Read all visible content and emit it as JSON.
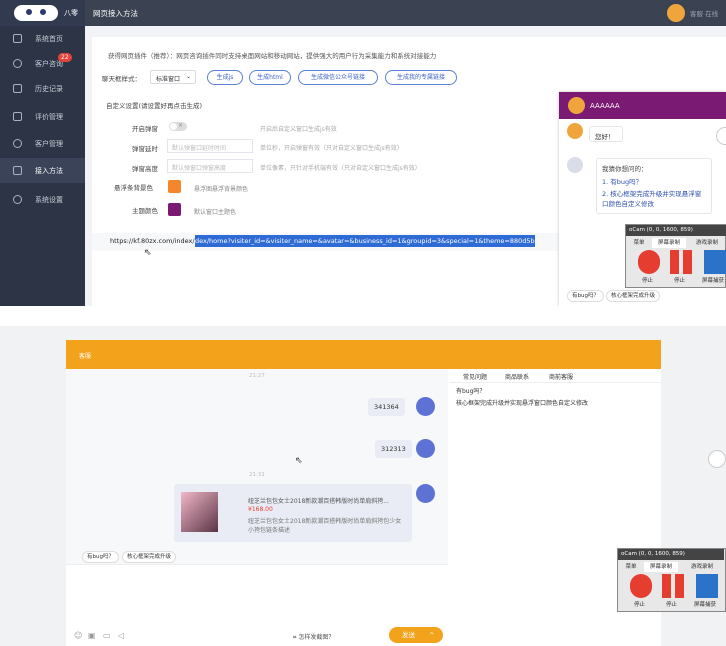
{
  "sidebar": {
    "brand": "八零",
    "items": [
      {
        "label": "系统首页"
      },
      {
        "label": "客户咨询",
        "badge": "22"
      },
      {
        "label": "历史记录"
      },
      {
        "label": "评价管理"
      },
      {
        "label": "客户管理"
      },
      {
        "label": "接入方法"
      },
      {
        "label": "系统设置"
      }
    ]
  },
  "topbar": {
    "title": "网页接入方法",
    "user": "客服 在线"
  },
  "main": {
    "intro": "获得网页插件（推荐）：网页咨询插件同时支持桌面网站和移动网站，提供强大的用户行为采集能力和系统对接能力",
    "style_label": "聊天框样式：",
    "style_value": "标准窗口",
    "buttons": [
      "生成js",
      "生成html",
      "生成微信公众号链接",
      "生成我的专属链接"
    ],
    "custom_title": "自定义设置(请设置好再点击生成)",
    "settings": [
      {
        "label": "开启弹窗",
        "value": "",
        "hint": "开启后自定义窗口生成js有效"
      },
      {
        "label": "弹窗延时",
        "value": "默认弹窗口延时时间",
        "hint": "单位秒，开启弹窗有效（只对自定义窗口生成js有效）"
      },
      {
        "label": "弹窗高度",
        "value": "默认弹窗口弹窗高度",
        "hint": "单位像素，只针对手机端有效（只对自定义窗口生成js有效）"
      },
      {
        "label": "悬浮条背景色",
        "value": "",
        "hint": "悬浮图悬浮背景颜色"
      },
      {
        "label": "主题颜色",
        "value": "",
        "hint": "默认窗口主题色"
      }
    ],
    "url_plain": "https://kf.80zx.com/index/in",
    "url_selected": "dex/home?visiter_id=&visiter_name=&avatar=&business_id=1&groupid=3&special=1&theme=880d5b"
  },
  "widget": {
    "name": "AAAAAA",
    "greeting": "您好！",
    "faq_title": "我猜你想问的：",
    "faq": [
      "1. 有bug吗？",
      "2. 核心框架完成升级并实现悬浮窗口颜色自定义修改"
    ],
    "quick": [
      "有bug吗？",
      "核心框架完成升级"
    ]
  },
  "ocam": {
    "title": "oCam (0, 0, 1600, 859)",
    "tabs": [
      "菜单",
      "屏幕录制",
      "游戏录制"
    ],
    "buttons": [
      "停止",
      "停止",
      "屏幕捕获"
    ]
  },
  "chat": {
    "title": "客服",
    "times": [
      "21:27",
      "21:31"
    ],
    "messages": [
      "341364",
      "312313"
    ],
    "product": {
      "title": "纽芝兰包包女士2018新款潮百搭韩版时尚单肩斜挎...",
      "price": "¥168.00",
      "desc": "纽芝兰包包女士2018新款潮百搭韩版时尚单肩斜挎包少女小挎包链条描述"
    },
    "quick": [
      "有bug吗？",
      "核心框架完成升级"
    ],
    "tabs": [
      "常见问题",
      "商品联系",
      "商前客服"
    ],
    "faq": [
      "有bug吗？",
      "核心框架完成升级并实现悬浮窗口颜色自定义修改"
    ],
    "screenshot": "怎样发截图？",
    "send": "发送",
    "send_arrow": "^"
  },
  "colors": {
    "accent": "#f3a21c",
    "theme": "#7a1a73",
    "orange": "#f5872a",
    "purple": "#7a1a73",
    "selection": "#2f6bd5"
  }
}
